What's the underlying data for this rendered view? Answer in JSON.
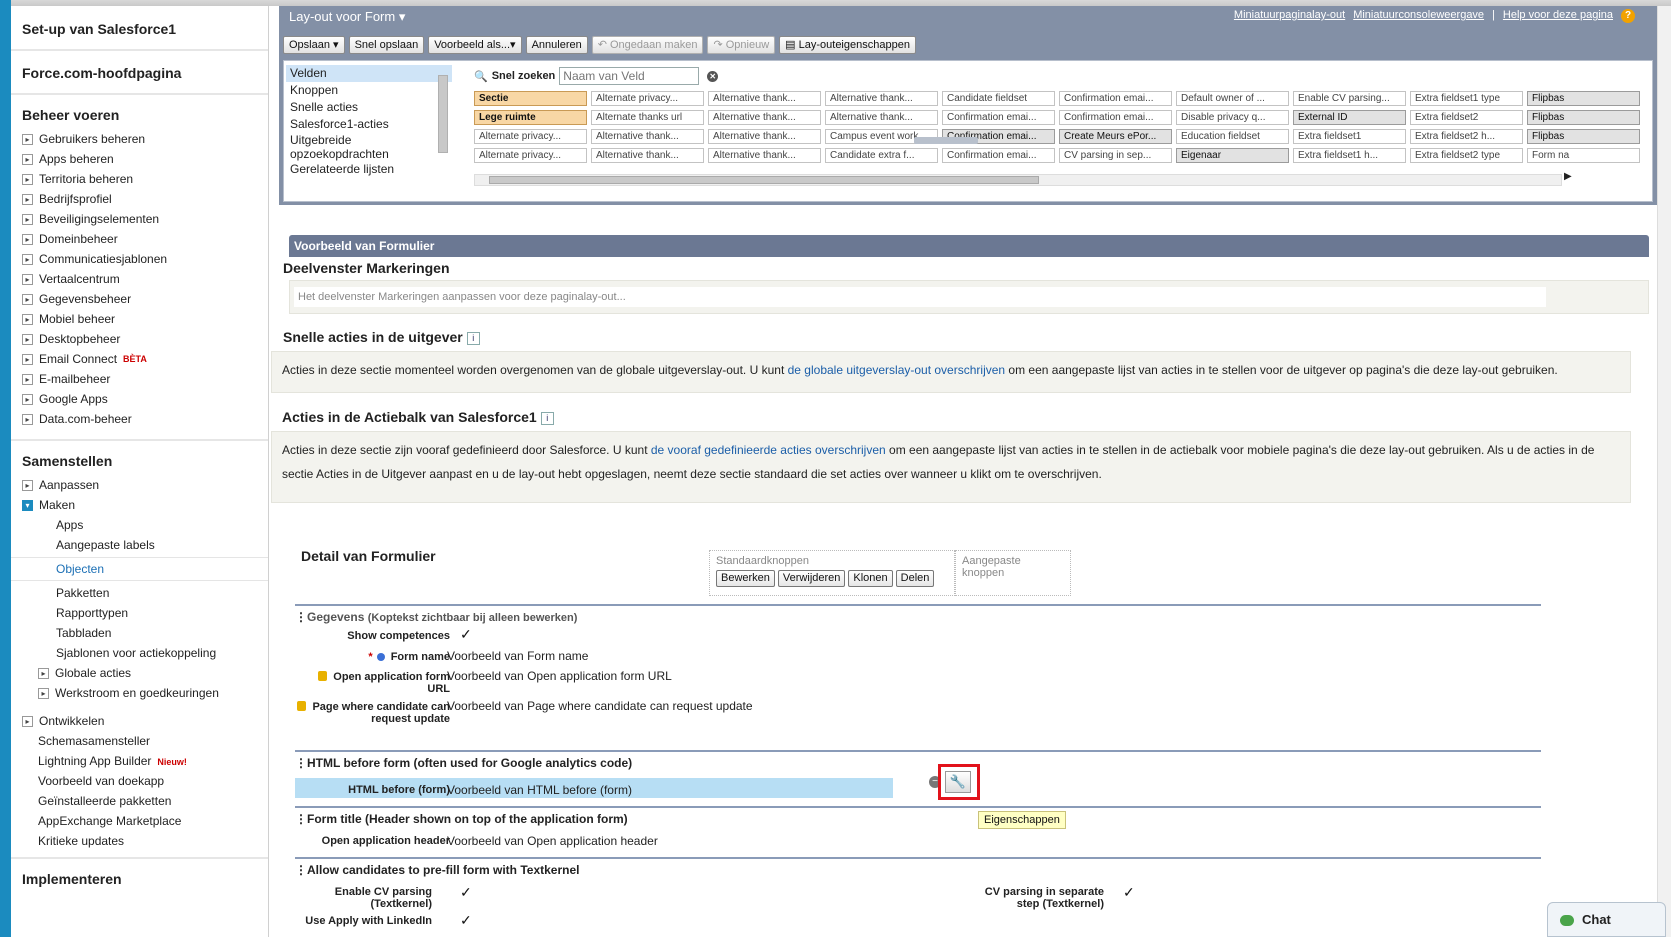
{
  "sidebar": {
    "setup_s1": "Set-up van Salesforce1",
    "force_home": "Force.com-hoofdpagina",
    "admin_title": "Beheer voeren",
    "admin_items": [
      "Gebruikers beheren",
      "Apps beheren",
      "Territoria beheren",
      "Bedrijfsprofiel",
      "Beveiligingselementen",
      "Domeinbeheer",
      "Communicatiesjablonen",
      "Vertaalcentrum",
      "Gegevensbeheer",
      "Mobiel beheer",
      "Desktopbeheer",
      "Email Connect",
      "E-mailbeheer",
      "Google Apps",
      "Data.com-beheer"
    ],
    "email_connect_badge": "BÈTA",
    "build_title": "Samenstellen",
    "customize": "Aanpassen",
    "create": "Maken",
    "create_sub": [
      "Apps",
      "Aangepaste labels",
      "Objecten",
      "Pakketten",
      "Rapporttypen",
      "Tabbladen",
      "Sjablonen voor actiekoppeling"
    ],
    "global_actions": "Globale acties",
    "workflow": "Werkstroom en goedkeuringen",
    "develop": "Ontwikkelen",
    "dev_items": [
      "Schemasamensteller",
      "Lightning App Builder",
      "Voorbeeld van doekapp",
      "Geïnstalleerde pakketten",
      "AppExchange Marketplace",
      "Kritieke updates"
    ],
    "lightning_badge": "Nieuw!",
    "deploy_title": "Implementeren"
  },
  "palette": {
    "title": "Lay-out voor Form",
    "links": [
      "Miniatuurpaginalay-out",
      "Miniatuurconsoleweergave",
      "|",
      "Help voor deze pagina"
    ],
    "help_icon": "?",
    "toolbar": {
      "save": "Opslaan",
      "quick_save": "Snel opslaan",
      "preview": "Voorbeeld als...",
      "cancel": "Annuleren",
      "undo": "Ongedaan maken",
      "redo": "Opnieuw",
      "layout_props": "Lay-outeigenschappen"
    },
    "categories": [
      "Velden",
      "Knoppen",
      "Snelle acties",
      "Salesforce1-acties",
      "Uitgebreide opzoekopdrachten",
      "Gerelateerde lijsten"
    ],
    "quick_search_label": "Snel zoeken",
    "quick_search_placeholder": "Naam van Veld",
    "field_rows": [
      [
        "Sectie",
        "Alternate privacy...",
        "Alternative thank...",
        "Alternative thank...",
        "Candidate fieldset",
        "Confirmation emai...",
        "Default owner of ...",
        "Enable CV parsing...",
        "Extra fieldset1 type",
        "Flipbas"
      ],
      [
        "Lege ruimte",
        "Alternate thanks url",
        "Alternative thank...",
        "Alternative thank...",
        "Confirmation emai...",
        "Confirmation emai...",
        "Disable privacy q...",
        "External ID",
        "Extra fieldset2",
        "Flipbas"
      ],
      [
        "Alternate privacy...",
        "Alternative thank...",
        "Alternative thank...",
        "Campus event work...",
        "Confirmation emai...",
        "Create Meurs ePor...",
        "Education fieldset",
        "Extra fieldset1",
        "Extra fieldset2 h...",
        "Flipbas"
      ],
      [
        "Alternate privacy...",
        "Alternative thank...",
        "Alternative thank...",
        "Candidate extra f...",
        "Confirmation emai...",
        "CV parsing in sep...",
        "Eigenaar",
        "Extra fieldset1 h...",
        "Extra fieldset2 type",
        "Form na"
      ]
    ]
  },
  "canvas": {
    "preview_header": "Voorbeeld van Formulier",
    "highlights_title": "Deelvenster Markeringen",
    "highlights_placeholder": "Het deelvenster Markeringen aanpassen voor deze paginalay-out...",
    "publisher_title": "Snelle acties in de uitgever",
    "publisher_text_1": "Acties in deze sectie momenteel worden overgenomen van de globale uitgeverslay-out. U kunt ",
    "publisher_link": "de globale uitgeverslay-out overschrijven",
    "publisher_text_2": " om een aangepaste lijst van acties in te stellen voor de uitgever op pagina's die deze lay-out gebruiken.",
    "actionbar_title": "Acties in de Actiebalk van Salesforce1",
    "actionbar_text_1": "Acties in deze sectie zijn vooraf gedefinieerd door Salesforce. U kunt ",
    "actionbar_link": "de vooraf gedefinieerde acties overschrijven",
    "actionbar_text_2": " om een aangepaste lijst van acties in te stellen in de actiebalk voor mobiele pagina's die deze lay-out gebruiken. Als u de acties in de sectie Acties in de Uitgever aanpast en u de lay-out hebt opgeslagen, neemt deze sectie standaard die set acties over wanneer u klikt om te overschrijven.",
    "info_icon": "i",
    "detail_title": "Detail van Formulier",
    "std_buttons_label": "Standaardknoppen",
    "std_buttons": [
      "Bewerken",
      "Verwijderen",
      "Klonen",
      "Delen"
    ],
    "custom_buttons_label": "Aangepaste knoppen",
    "sec_info": "Gegevens",
    "sec_info_sub": "(Koptekst zichtbaar bij alleen bewerken)",
    "f_show_comp": "Show competences",
    "f_form_name": "Form name",
    "f_form_name_val": "Voorbeeld van Form name",
    "f_open_app": "Open application form URL",
    "f_open_app_val": "Voorbeeld van Open application form URL",
    "f_page_where": "Page where candidate can request update",
    "f_page_where_val": "Voorbeeld van Page where candidate can request update",
    "sec_html": "HTML before form (often used for Google analytics code)",
    "f_html_before": "HTML before (form)",
    "f_html_before_val": "Voorbeeld van HTML before (form)",
    "tooltip": "Eigenschappen",
    "sec_form_title": "Form title (Header shown on top of the application form)",
    "f_open_header": "Open application header",
    "f_open_header_val": "Voorbeeld van Open application header",
    "sec_prefill": "Allow candidates to pre-fill form with Textkernel",
    "f_enable_cv": "Enable CV parsing (Textkernel)",
    "f_cv_separate": "CV parsing in separate step (Textkernel)",
    "f_apply_linkedin": "Use Apply with LinkedIn",
    "checkmark": "✓"
  },
  "chat": {
    "label": "Chat"
  }
}
